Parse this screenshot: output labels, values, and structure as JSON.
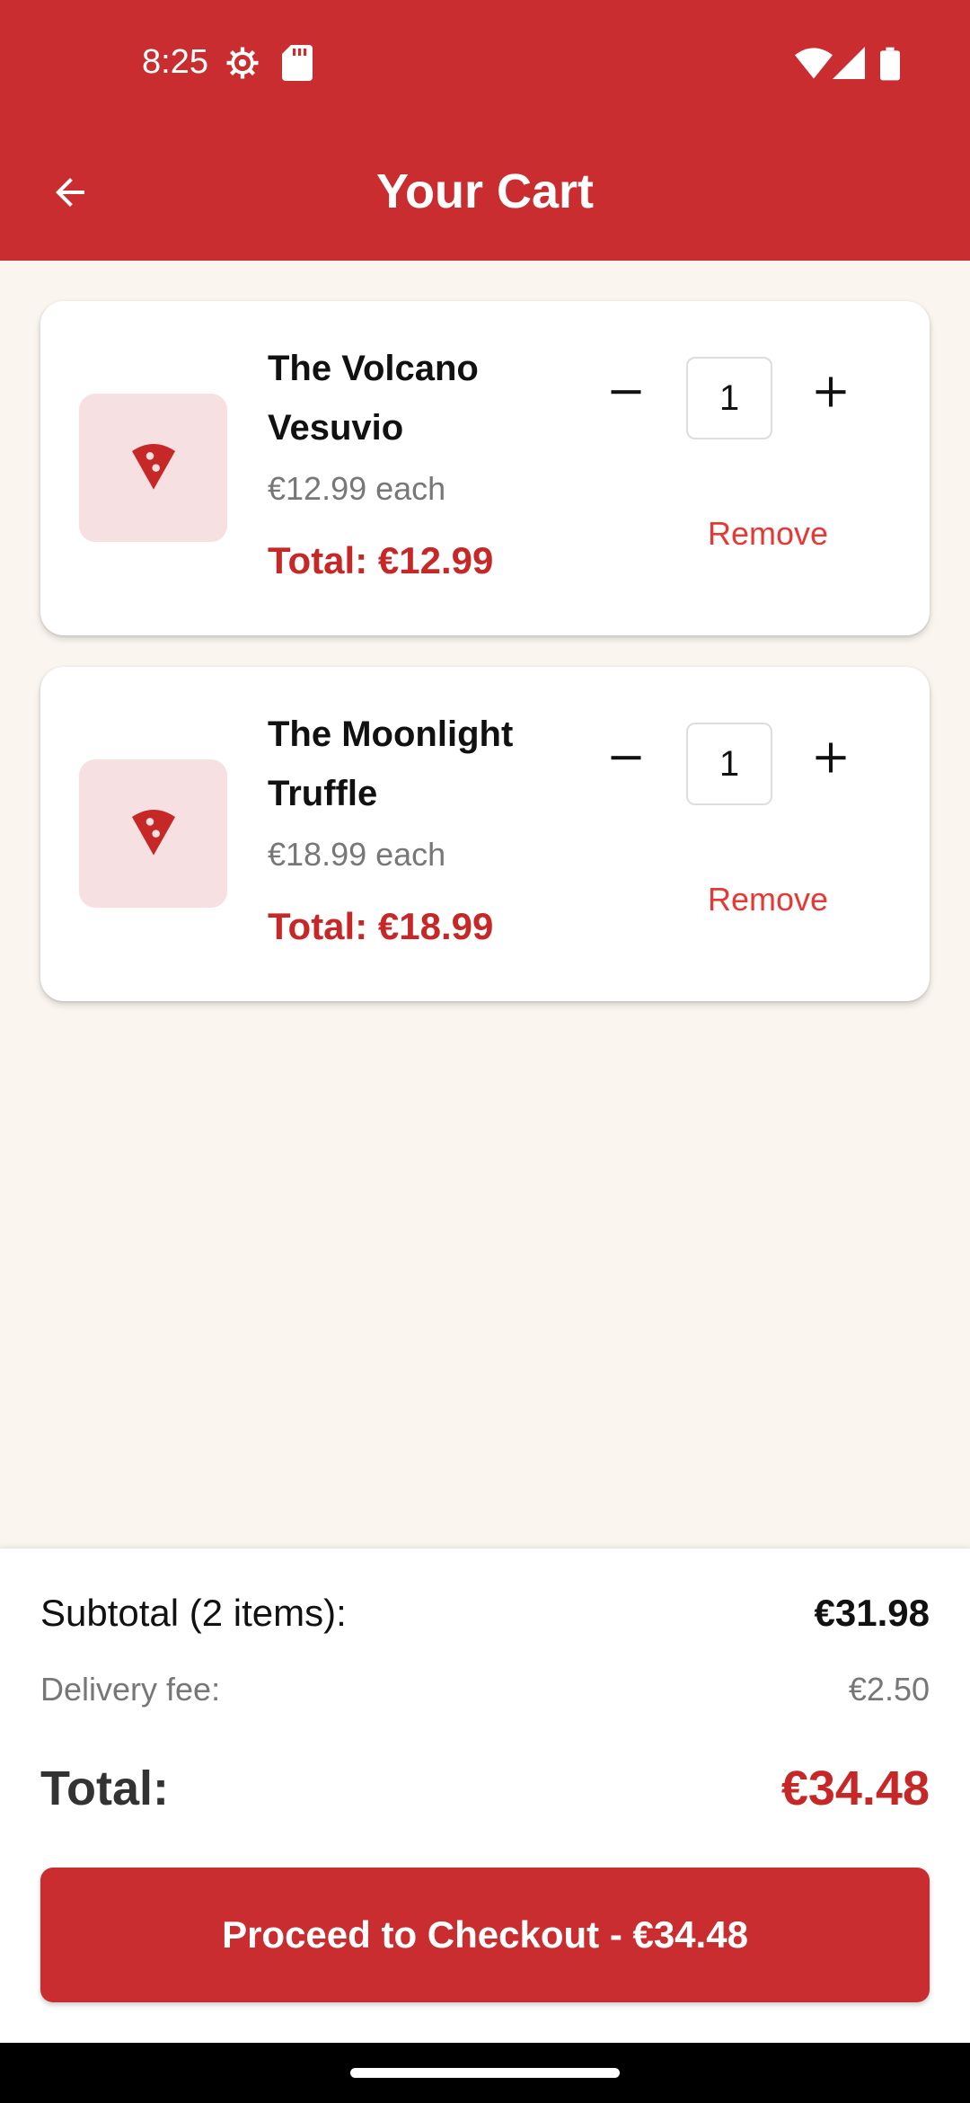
{
  "status_bar": {
    "time": "8:25",
    "icons": [
      "gear-icon",
      "sd-card-icon",
      "wifi-icon",
      "signal-icon",
      "battery-icon"
    ]
  },
  "app_bar": {
    "title": "Your Cart",
    "back_icon": "arrow-back-icon"
  },
  "cart": {
    "items": [
      {
        "name": "The Volcano Vesuvio",
        "price_each": "€12.99 each",
        "total": "Total: €12.99",
        "quantity": "1",
        "remove_label": "Remove",
        "icon": "pizza-slice-icon"
      },
      {
        "name": "The Moonlight Truffle",
        "price_each": "€18.99 each",
        "total": "Total: €18.99",
        "quantity": "1",
        "remove_label": "Remove",
        "icon": "pizza-slice-icon"
      }
    ]
  },
  "summary": {
    "subtotal_label": "Subtotal (2 items):",
    "subtotal_value": "€31.98",
    "delivery_label": "Delivery fee:",
    "delivery_value": "€2.50",
    "total_label": "Total:",
    "total_value": "€34.48",
    "checkout_label": "Proceed to Checkout - €34.48"
  },
  "colors": {
    "primary": "#c92d2f",
    "accent_text": "#c62828",
    "remove_text": "#e53935",
    "background": "#faf5ef",
    "thumb_bg": "#f6e0e1"
  }
}
